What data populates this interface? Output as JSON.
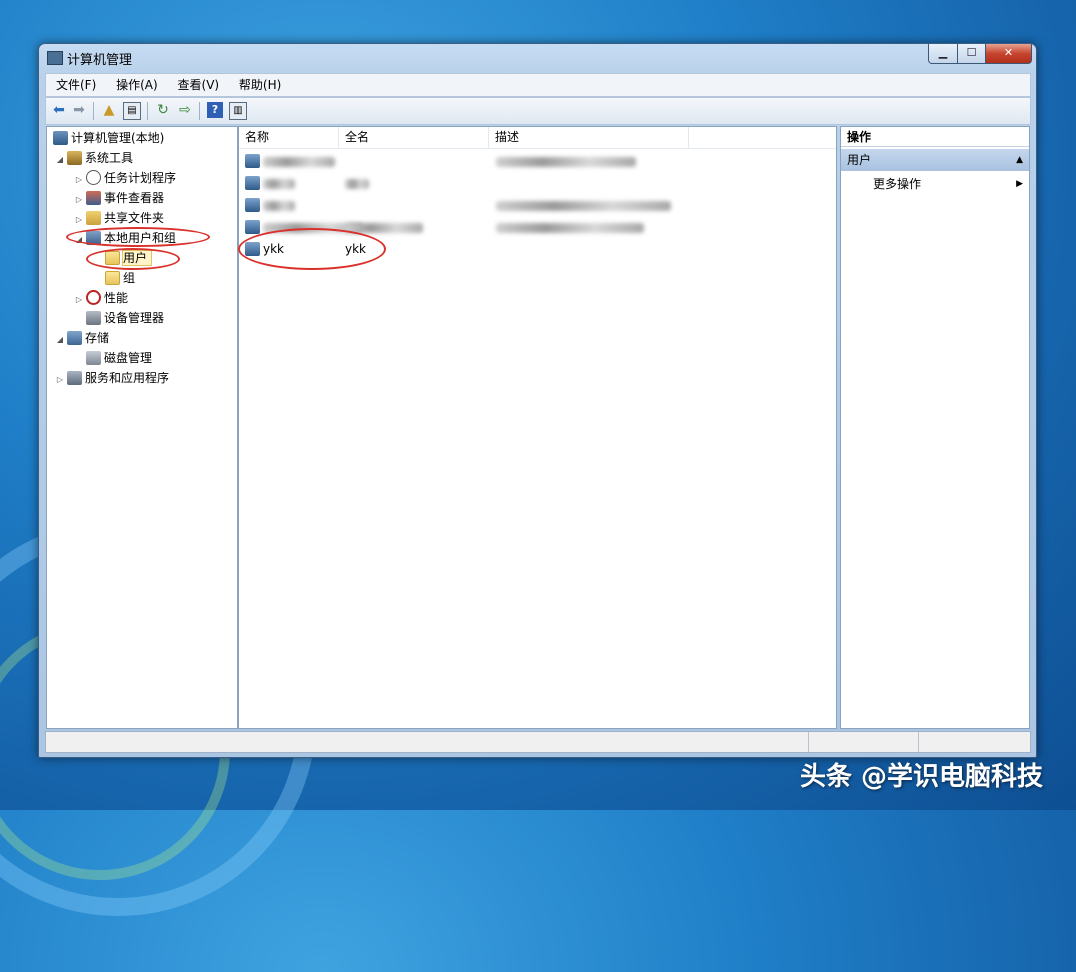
{
  "window": {
    "title": "计算机管理"
  },
  "menu": [
    "文件(F)",
    "操作(A)",
    "查看(V)",
    "帮助(H)"
  ],
  "tree": {
    "root": "计算机管理(本地)",
    "system_tools": "系统工具",
    "task_scheduler": "任务计划程序",
    "event_viewer": "事件查看器",
    "shared_folders": "共享文件夹",
    "local_users_groups": "本地用户和组",
    "users": "用户",
    "groups": "组",
    "performance": "性能",
    "device_manager": "设备管理器",
    "storage": "存储",
    "disk_management": "磁盘管理",
    "services_apps": "服务和应用程序"
  },
  "list": {
    "columns": [
      "名称",
      "全名",
      "描述"
    ],
    "rows": [
      {
        "name": "",
        "fullname": "",
        "description": ""
      },
      {
        "name": "",
        "fullname": "",
        "description": ""
      },
      {
        "name": "",
        "fullname": "",
        "description": ""
      },
      {
        "name": "",
        "fullname": "",
        "description": ""
      },
      {
        "name": "ykk",
        "fullname": "ykk",
        "description": ""
      }
    ]
  },
  "actions": {
    "header": "操作",
    "group": "用户",
    "more": "更多操作"
  },
  "watermark": "头条 @学识电脑科技",
  "colors": {
    "annotation": "#d9312b",
    "selection": "#fff5c9",
    "action_group": "#b9cde6"
  },
  "icons": [
    "back-arrow-icon",
    "forward-arrow-icon",
    "up-folder-icon",
    "show-tree-icon",
    "refresh-icon",
    "export-icon",
    "help-icon",
    "properties-icon"
  ]
}
